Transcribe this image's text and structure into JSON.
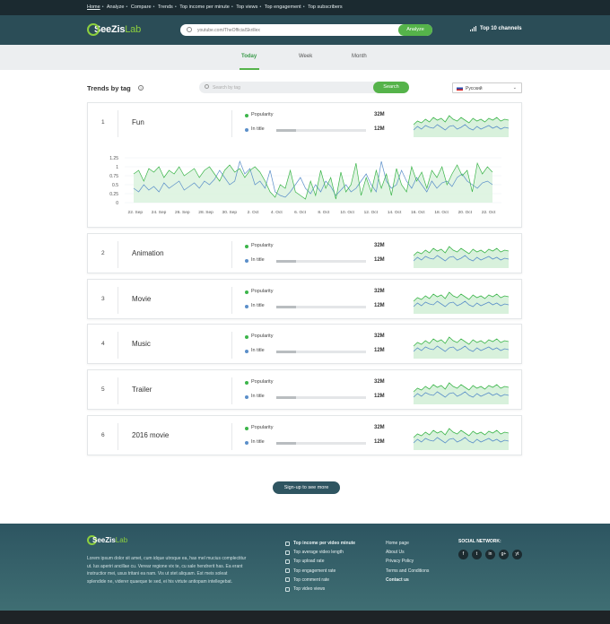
{
  "topnav": {
    "links": [
      "Home",
      "Analyze",
      "Compare",
      "Trends",
      "Top income per minute",
      "Top views",
      "Top engagement",
      "Top subscribers"
    ]
  },
  "header": {
    "logo_main": "SeeZis",
    "logo_accent": "Lab",
    "search_placeholder": "youtube.com/TheOfficialSkrillex",
    "analyze_label": "Analyze",
    "top10_label": "Top 10 channels"
  },
  "period_tabs": [
    {
      "label": "Today",
      "active": true
    },
    {
      "label": "Week",
      "active": false
    },
    {
      "label": "Month",
      "active": false
    }
  ],
  "trends": {
    "title": "Trends by tag",
    "info_glyph": "?",
    "search_placeholder": "Search by tag",
    "search_label": "Search",
    "language": "Русский"
  },
  "metric_labels": {
    "popularity": "Popularity",
    "in_title": "In title"
  },
  "colors": {
    "green": "#3cb54a",
    "blue": "#5b8fc9",
    "fill": "#d8f1dc"
  },
  "rows": [
    {
      "rank": "1",
      "tag": "Fun",
      "popularity": "32M",
      "in_title": "12M",
      "in_title_level": 0.22
    },
    {
      "rank": "2",
      "tag": "Animation",
      "popularity": "32M",
      "in_title": "12M",
      "in_title_level": 0.22
    },
    {
      "rank": "3",
      "tag": "Movie",
      "popularity": "32M",
      "in_title": "12M",
      "in_title_level": 0.22
    },
    {
      "rank": "4",
      "tag": "Music",
      "popularity": "32M",
      "in_title": "12M",
      "in_title_level": 0.22
    },
    {
      "rank": "5",
      "tag": "Trailer",
      "popularity": "32M",
      "in_title": "12M",
      "in_title_level": 0.22
    },
    {
      "rank": "6",
      "tag": "2016 movie",
      "popularity": "32M",
      "in_title": "12M",
      "in_title_level": 0.22
    }
  ],
  "chart_data": {
    "type": "line",
    "ylim": [
      0,
      1.25
    ],
    "yticks": [
      "1.25",
      "1",
      "0.75",
      "0.5",
      "0.25",
      "0"
    ],
    "xticks": [
      "22. Sep",
      "24. Sep",
      "26. Sep",
      "28. Sep",
      "30. Sep",
      "2. Oct",
      "4. Oct",
      "6. Oct",
      "8. Oct",
      "10. Oct",
      "12. Oct",
      "14. Oct",
      "16. Oct",
      "18. Oct",
      "20. Oct",
      "22. Oct"
    ],
    "series": [
      {
        "values": [
          0.8,
          0.9,
          0.6,
          0.95,
          0.85,
          1.0,
          0.7,
          0.9,
          0.8,
          1.0,
          0.75,
          0.85,
          0.95,
          0.7,
          0.9,
          1.0,
          0.8,
          0.6,
          0.9,
          1.05,
          0.85,
          0.95,
          0.7,
          0.9,
          1.0,
          0.85,
          0.6,
          0.3,
          0.15,
          0.5,
          0.4,
          0.9,
          0.3,
          0.2,
          0.1,
          0.6,
          0.2,
          0.9,
          0.4,
          0.7,
          0.1,
          0.85,
          0.3,
          0.5,
          1.1,
          0.2,
          0.7,
          0.3,
          0.9,
          0.4,
          0.8,
          0.2,
          0.95,
          0.5,
          0.3,
          1.0,
          0.6,
          0.85,
          0.4,
          0.9,
          0.7,
          1.0,
          0.5,
          0.8,
          1.05,
          0.75,
          0.9,
          0.3,
          1.1,
          0.8,
          1.0,
          0.85
        ]
      },
      {
        "values": [
          0.4,
          0.3,
          0.5,
          0.35,
          0.45,
          0.3,
          0.55,
          0.4,
          0.5,
          0.6,
          0.35,
          0.45,
          0.55,
          0.4,
          0.6,
          0.5,
          0.65,
          0.9,
          0.7,
          0.5,
          0.6,
          1.15,
          0.8,
          0.95,
          0.5,
          0.6,
          0.4,
          0.9,
          0.3,
          0.2,
          0.15,
          0.3,
          0.5,
          0.7,
          0.4,
          0.25,
          0.5,
          0.3,
          0.6,
          0.45,
          0.2,
          0.35,
          0.5,
          0.3,
          0.4,
          0.6,
          0.8,
          0.5,
          0.3,
          1.15,
          0.6,
          0.4,
          0.5,
          0.9,
          0.6,
          0.4,
          0.7,
          0.5,
          0.3,
          0.6,
          0.4,
          0.55,
          0.6,
          0.45,
          0.7,
          0.8,
          0.6,
          0.5,
          0.4,
          0.55,
          0.6,
          0.5
        ]
      }
    ]
  },
  "signup_label": "Sign-up to see more",
  "footer": {
    "description": "Lorem ipsum dolor sit amet, cum idque utroque ea, has mel mucius complectitur ut. Ius aperiri ancillae cu. Verear regione vix te, cu sale hendrerit has. Ea erant instructior mei, usus tritani ea nam. Vis ut stet aliquam. Est meis soleat splendide ne, viderer quaeque te sed, ei his virtute antiopam intellegebat.",
    "top_lists": [
      "Top income per video minute",
      "Top average video length",
      "Top upload rate",
      "Top engagement rate",
      "Top comment rate",
      "Top video views"
    ],
    "links": [
      "Home page",
      "About Us",
      "Privacy Policy",
      "Terms and Conditions",
      "Contact us"
    ],
    "social_title": "SOCIAL NETWORK:",
    "social": [
      "f",
      "t",
      "in",
      "g+",
      "yt"
    ]
  }
}
